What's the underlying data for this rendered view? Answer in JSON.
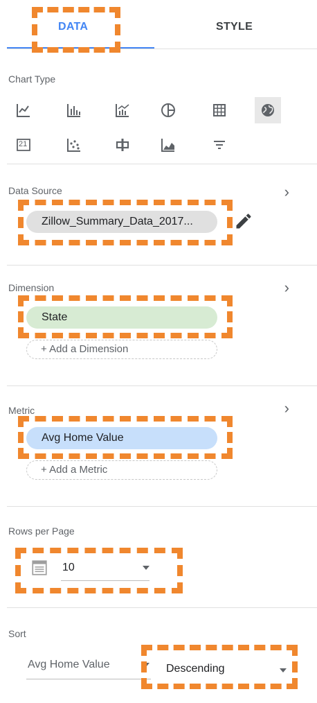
{
  "tabs": [
    {
      "label": "DATA",
      "active": true
    },
    {
      "label": "STYLE",
      "active": false
    }
  ],
  "chart_type": {
    "label": "Chart Type",
    "icons": [
      "line-chart-icon",
      "bar-chart-icon",
      "combo-chart-icon",
      "pie-chart-icon",
      "table-icon",
      "geo-map-icon",
      "scorecard-icon",
      "scatter-chart-icon",
      "bullet-chart-icon",
      "area-chart-icon",
      "filter-control-icon"
    ],
    "scorecard_text": "21"
  },
  "data_source": {
    "label": "Data Source",
    "value": "Zillow_Summary_Data_2017..."
  },
  "dimension": {
    "label": "Dimension",
    "chip": "State",
    "add_label": "+ Add a Dimension"
  },
  "metric": {
    "label": "Metric",
    "chip": "Avg Home Value",
    "add_label": "+ Add a Metric"
  },
  "rows_per_page": {
    "label": "Rows per Page",
    "value": "10"
  },
  "sort": {
    "label": "Sort",
    "field": "Avg Home Value",
    "order": "Descending"
  },
  "colors": {
    "accent": "#4285f4",
    "highlight": "#f0872e",
    "source_chip": "#e0e0e0",
    "dimension_chip": "#d7ebd3",
    "metric_chip": "#c7dffb"
  }
}
